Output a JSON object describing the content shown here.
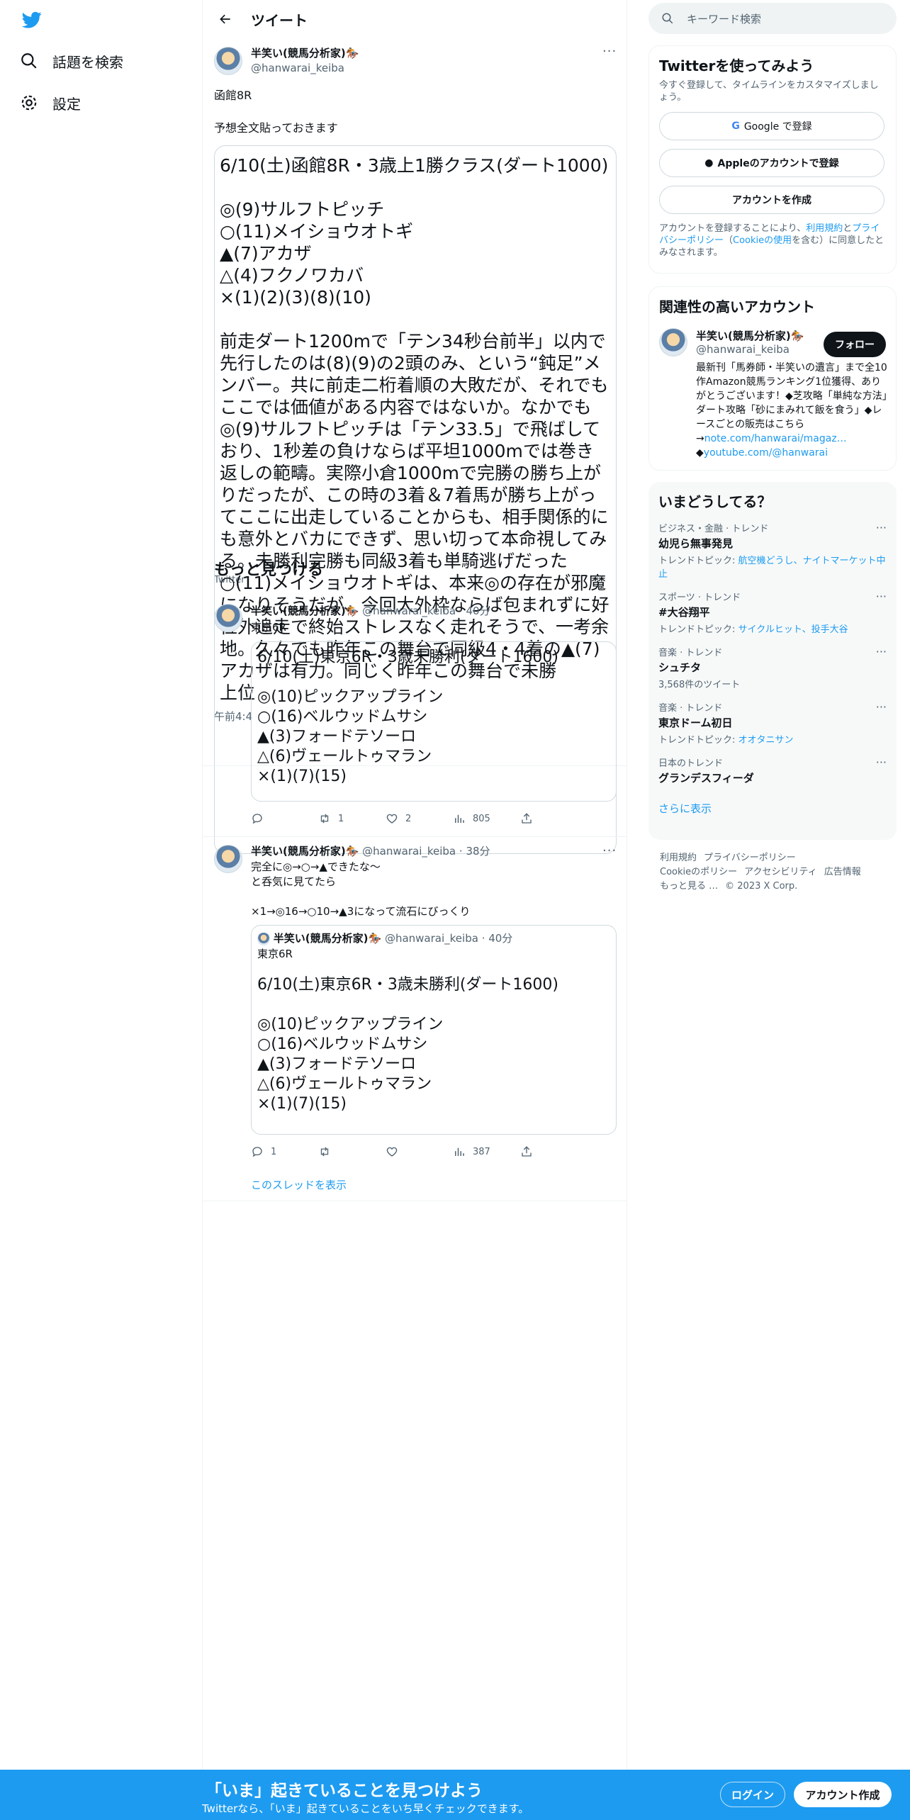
{
  "nav": {
    "explore": "話題を検索",
    "settings": "設定"
  },
  "header": {
    "title": "ツイート"
  },
  "main_tweet": {
    "name": "半笑い(競馬分析家)🏇",
    "handle": "@hanwarai_keiba",
    "line1": "函館8R",
    "line2": "予想全文貼っておきます",
    "card": {
      "title": "6/10(土)函館8R・3歳上1勝クラス(ダート1000)",
      "picks": [
        "◎(9)サルフトピッチ",
        "○(11)メイショウオトギ",
        "▲(7)アカザ",
        "△(4)フクノワカバ",
        "×(1)(2)(3)(8)(10)"
      ],
      "body": "前走ダート1200mで「テン34秒台前半」以内で先行したのは(8)(9)の2頭のみ、という“鈍足”メンバー。共に前走二桁着順の大敗だが、それでもここでは価値がある内容ではないか。なかでも◎(9)サルフトピッチは「テン33.5」で飛ばしており、1秒差の負けならば平坦1000mでは巻き返しの範疇。実際小倉1000mで完勝の勝ち上がりだったが、この時の3着＆7着馬が勝ち上がってここに出走していることからも、相手関係的にも意外とバカにできず、思い切って本命視してみる。未勝利完勝も同級3着も単騎逃げだった○(11)メイショウオトギは、本来◎の存在が邪魔になりそうだが、今回大外枠ならば包まれずに好位外追走で終始ストレスなく走れそうで、一考余地。久々でも昨年この舞台で同級4・4着の▲(7)アカザは有力。同じく昨年この舞台で未勝",
      "tail": "上位"
    },
    "time": "午前4:4",
    "discover_title": "もっと見つける",
    "discover_sub": "Twitter"
  },
  "reply1": {
    "name": "半笑い(競馬分析家)🏇",
    "handle": "@hanwarai_keiba",
    "time": "· 40分",
    "quote": {
      "label": "東京6R",
      "title": "6/10(土)東京6R・3歳未勝利(ダート1600)",
      "picks": [
        "◎(10)ピックアップライン",
        "○(16)ベルウッドムサシ",
        "▲(3)フォードテソーロ",
        "△(6)ヴェールトゥマラン",
        "×(1)(7)(15)"
      ]
    },
    "replies": "",
    "retweets": "1",
    "likes": "2",
    "views": "805"
  },
  "reply2": {
    "name": "半笑い(競馬分析家)🏇",
    "handle": "@hanwarai_keiba",
    "time": "· 38分",
    "text1": "完全に◎→○→▲できたな〜",
    "text2": "と呑気に見てたら",
    "text3": "×1→◎16→○10→▲3になって流石にびっくり",
    "quote": {
      "name": "半笑い(競馬分析家)🏇",
      "handle": "@hanwarai_keiba",
      "time": "· 40分",
      "label": "東京6R",
      "title": "6/10(土)東京6R・3歳未勝利(ダート1600)",
      "picks": [
        "◎(10)ピックアップライン",
        "○(16)ベルウッドムサシ",
        "▲(3)フォードテソーロ",
        "△(6)ヴェールトゥマラン",
        "×(1)(7)(15)"
      ]
    },
    "replies": "1",
    "retweets": "",
    "likes": "",
    "views": "387",
    "show_thread": "このスレッドを表示"
  },
  "search": {
    "placeholder": "キーワード検索"
  },
  "signup": {
    "title": "Twitterを使ってみよう",
    "sub": "今すぐ登録して、タイムラインをカスタマイズしましょう。",
    "google": "Google で登録",
    "apple": "Appleのアカウントで登録",
    "create": "アカウントを作成",
    "legal_pre": "アカウントを登録することにより、",
    "legal_terms": "利用規約",
    "legal_and": "と",
    "legal_privacy": "プライバシーポリシー",
    "legal_paren_open": "（",
    "legal_cookie": "Cookieの使用",
    "legal_post": "を含む）に同意したとみなされます。"
  },
  "related": {
    "title": "関連性の高いアカウント",
    "name": "半笑い(競馬分析家)🏇",
    "handle": "@hanwarai_keiba",
    "follow": "フォロー",
    "bio": "最新刊「馬券師・半笑いの遺言」まで全10作Amazon競馬ランキング1位獲得、ありがとうございます！◆芝攻略「単純な方法」ダート攻略「砂にまみれて飯を食う」◆レースごとの販売はこちら→",
    "link1": "note.com/hanwarai/magaz…",
    "link2_prefix": "◆",
    "link2": "youtube.com/@hanwarai"
  },
  "trends": {
    "title": "いまどうしてる？",
    "items": [
      {
        "cat": "ビジネス・金融 · トレンド",
        "name": "幼児ら無事発見",
        "sub_label": "トレンドトピック: ",
        "sub_links": "航空機どうし、ナイトマーケット中止"
      },
      {
        "cat": "スポーツ · トレンド",
        "name": "#大谷翔平",
        "sub_label": "トレンドトピック: ",
        "sub_links": "サイクルヒット、投手大谷"
      },
      {
        "cat": "音楽 · トレンド",
        "name": "シュチタ",
        "sub_label": "3,568件のツイート",
        "sub_links": ""
      },
      {
        "cat": "音楽 · トレンド",
        "name": "東京ドーム初日",
        "sub_label": "トレンドトピック: ",
        "sub_links": "オオタニサン"
      },
      {
        "cat": "日本のトレンド",
        "name": "グランデスフィーダ",
        "sub_label": "",
        "sub_links": ""
      }
    ],
    "show_more": "さらに表示"
  },
  "footer": {
    "terms": "利用規約",
    "privacy": "プライバシーポリシー",
    "cookie": "Cookieのポリシー",
    "accessibility": "アクセシビリティ",
    "ads": "広告情報",
    "more": "もっと見る …",
    "copyright": "© 2023 X Corp."
  },
  "bottombar": {
    "title": "「いま」起きていることを見つけよう",
    "sub": "Twitterなら、「いま」起きていることをいち早くチェックできます。",
    "login": "ログイン",
    "signup": "アカウント作成"
  },
  "colors": {
    "accent": "#1d9bf0",
    "text": "#0f1419",
    "muted": "#536471"
  }
}
